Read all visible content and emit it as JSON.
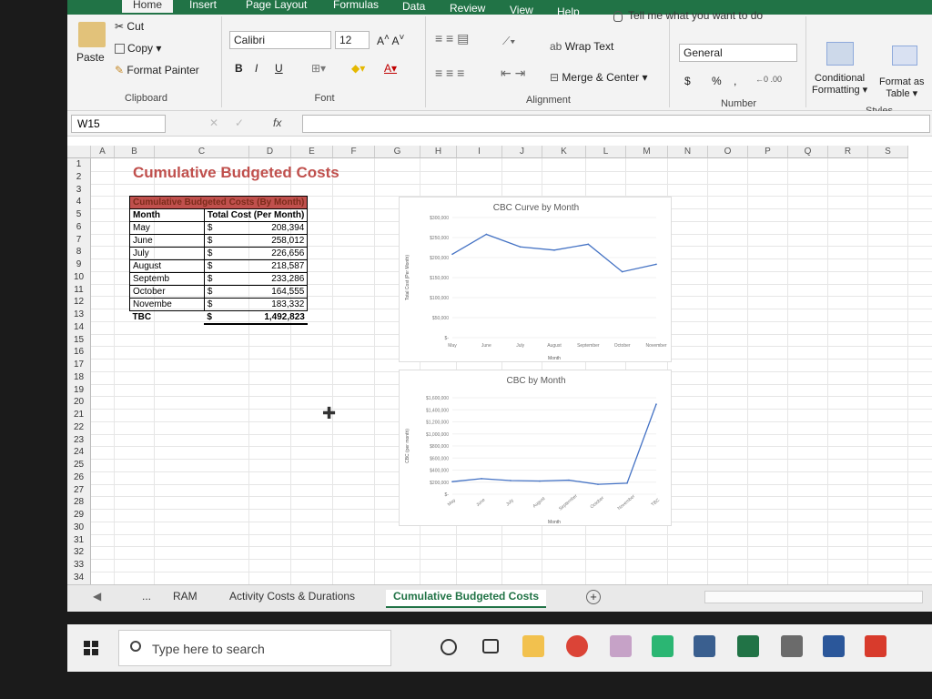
{
  "ribbon_tabs": [
    "Home",
    "Insert",
    "Page Layout",
    "Formulas",
    "Data",
    "Review",
    "View",
    "Help"
  ],
  "tell_me": "Tell me what you want to do",
  "clipboard": {
    "paste": "Paste",
    "cut": "Cut",
    "copy": "Copy",
    "format_painter": "Format Painter",
    "label": "Clipboard"
  },
  "font": {
    "name": "Calibri",
    "size": "12",
    "label": "Font",
    "bold": "B",
    "italic": "I",
    "underline": "U"
  },
  "alignment": {
    "wrap": "Wrap Text",
    "merge": "Merge & Center",
    "label": "Alignment"
  },
  "number": {
    "format": "General",
    "currency": "$",
    "percent": "%",
    "comma": ",",
    "label": "Number"
  },
  "styles": {
    "conditional": "Conditional",
    "conditional2": "Formatting",
    "format_as": "Format as",
    "format_as2": "Table",
    "label": "Styles"
  },
  "namebox": "W15",
  "fx": "fx",
  "columns": [
    "A",
    "B",
    "C",
    "D",
    "E",
    "F",
    "G",
    "H",
    "I",
    "J",
    "K",
    "L",
    "M",
    "N",
    "O",
    "P",
    "Q",
    "R",
    "S"
  ],
  "rows": [
    "1",
    "2",
    "3",
    "4",
    "5",
    "6",
    "7",
    "8",
    "9",
    "10",
    "11",
    "12",
    "13",
    "14",
    "15",
    "16",
    "17",
    "18",
    "19",
    "20",
    "21",
    "22",
    "23",
    "24",
    "25",
    "26",
    "27",
    "28",
    "29",
    "30",
    "31",
    "32",
    "33",
    "34"
  ],
  "sheet_title": "Cumulative Budgeted Costs",
  "table": {
    "header": "Cumulative Budgeted Costs (By Month)",
    "col1": "Month",
    "col2": "Total Cost (Per Month)",
    "rows": [
      {
        "month": "May",
        "cur": "$",
        "val": "208,394"
      },
      {
        "month": "June",
        "cur": "$",
        "val": "258,012"
      },
      {
        "month": "July",
        "cur": "$",
        "val": "226,656"
      },
      {
        "month": "August",
        "cur": "$",
        "val": "218,587"
      },
      {
        "month": "Septemb",
        "cur": "$",
        "val": "233,286"
      },
      {
        "month": "October",
        "cur": "$",
        "val": "164,555"
      },
      {
        "month": "Novembe",
        "cur": "$",
        "val": "183,332"
      }
    ],
    "total": {
      "month": "TBC",
      "cur": "$",
      "val": "1,492,823"
    }
  },
  "chart_data": [
    {
      "type": "line",
      "title": "CBC Curve by Month",
      "xlabel": "Month",
      "ylabel": "Total Cost (Per Month)",
      "categories": [
        "May",
        "June",
        "July",
        "August",
        "September",
        "October",
        "November"
      ],
      "values": [
        208394,
        258012,
        226656,
        218587,
        233286,
        164555,
        183332
      ],
      "yticks": [
        "$300,000",
        "$250,000",
        "$200,000",
        "$150,000",
        "$100,000",
        "$50,000",
        "$-"
      ],
      "ylim": [
        0,
        300000
      ],
      "color": "#4472c4"
    },
    {
      "type": "line",
      "title": "CBC by Month",
      "xlabel": "Month",
      "ylabel": "CBC (per month)",
      "categories": [
        "May",
        "June",
        "July",
        "August",
        "September",
        "October",
        "November",
        "TBC"
      ],
      "values": [
        208394,
        258012,
        226656,
        218587,
        233286,
        164555,
        183332,
        1492823
      ],
      "yticks": [
        "$1,600,000",
        "$1,400,000",
        "$1,200,000",
        "$1,000,000",
        "$800,000",
        "$600,000",
        "$400,000",
        "$200,000",
        "$-"
      ],
      "ylim": [
        0,
        1600000
      ],
      "color": "#4472c4"
    }
  ],
  "sheet_tabs": {
    "more": "...",
    "tabs": [
      "RAM",
      "Activity Costs & Durations",
      "Cumulative Budgeted Costs"
    ],
    "add": "+"
  },
  "taskbar": {
    "search": "Type here to search"
  },
  "colors": {
    "excel_green": "#217346",
    "title_red": "#c0504d",
    "line": "#4472c4"
  }
}
